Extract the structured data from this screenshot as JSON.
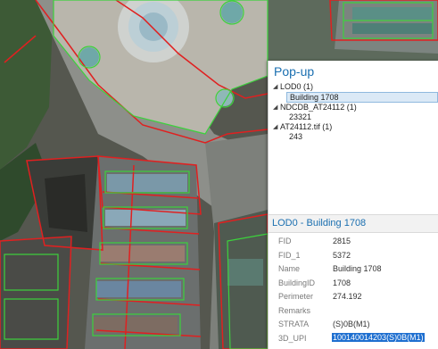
{
  "popup": {
    "title": "Pop-up",
    "tree": [
      {
        "label": "LOD0  (1)",
        "children": [
          "Building 1708"
        ],
        "selected_child": 0
      },
      {
        "label": "NDCDB_AT24112  (1)",
        "children": [
          "23321"
        ]
      },
      {
        "label": "AT24112.tif  (1)",
        "children": [
          "243"
        ]
      }
    ],
    "details_title": "LOD0 - Building 1708",
    "fields": [
      {
        "key": "FID",
        "value": "2815"
      },
      {
        "key": "FID_1",
        "value": "5372"
      },
      {
        "key": "Name",
        "value": "Building 1708"
      },
      {
        "key": "BuildingID",
        "value": "1708"
      },
      {
        "key": "Perimeter",
        "value": "274.192"
      },
      {
        "key": "Remarks",
        "value": ""
      },
      {
        "key": "STRATA",
        "value": "(S)0B(M1)"
      },
      {
        "key": "3D_UPI",
        "value": "100140014203(S)0B(M1)"
      }
    ]
  },
  "colors": {
    "title_blue": "#1a6fb0",
    "selection_bg": "#dbe9f6",
    "highlight_bg": "#1e6fd0",
    "parcel_red": "#e02020",
    "building_green": "#3cd23c"
  }
}
